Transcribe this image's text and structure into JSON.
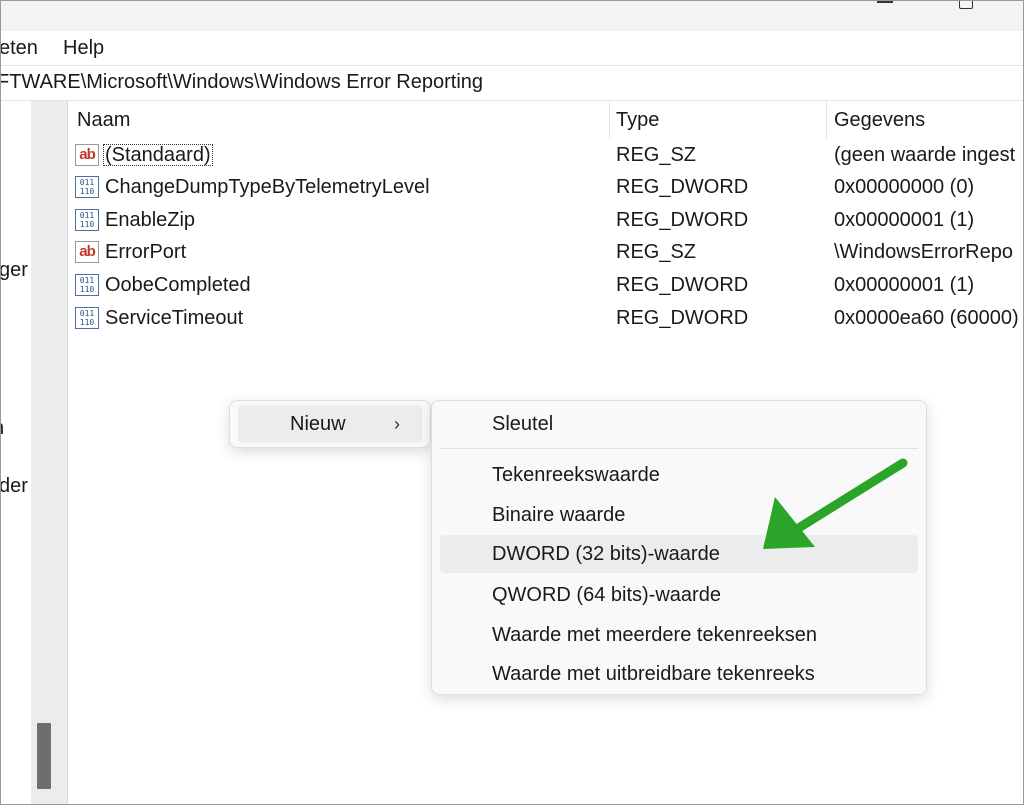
{
  "menu": [
    "eten",
    "Help"
  ],
  "address": "FTWARE\\Microsoft\\Windows\\Windows Error Reporting",
  "tree_fragments": [
    "ger",
    "n",
    "der"
  ],
  "columns": {
    "name": "Naam",
    "type": "Type",
    "data": "Gegevens"
  },
  "rows": [
    {
      "icon": "string-value-icon",
      "glyph": "ab",
      "name": "(Standaard)",
      "type": "REG_SZ",
      "data": "(geen waarde ingest"
    },
    {
      "icon": "binary-value-icon",
      "glyph": "011\n110",
      "name": "ChangeDumpTypeByTelemetryLevel",
      "type": "REG_DWORD",
      "data": "0x00000000 (0)"
    },
    {
      "icon": "binary-value-icon",
      "glyph": "011\n110",
      "name": "EnableZip",
      "type": "REG_DWORD",
      "data": "0x00000001 (1)"
    },
    {
      "icon": "string-value-icon",
      "glyph": "ab",
      "name": "ErrorPort",
      "type": "REG_SZ",
      "data": "\\WindowsErrorRepo"
    },
    {
      "icon": "binary-value-icon",
      "glyph": "011\n110",
      "name": "OobeCompleted",
      "type": "REG_DWORD",
      "data": "0x00000001 (1)"
    },
    {
      "icon": "binary-value-icon",
      "glyph": "011\n110",
      "name": "ServiceTimeout",
      "type": "REG_DWORD",
      "data": "0x0000ea60 (60000)"
    }
  ],
  "context_menu": {
    "new_label": "Nieuw",
    "chevron": "›"
  },
  "submenu": {
    "key": "Sleutel",
    "items": [
      "Tekenreekswaarde",
      "Binaire waarde",
      "DWORD (32 bits)-waarde",
      "QWORD (64 bits)-waarde",
      "Waarde met meerdere tekenreeksen",
      "Waarde met uitbreidbare tekenreeks"
    ],
    "highlighted": "DWORD (32 bits)-waarde"
  },
  "colors": {
    "arrow": "#2aa52a",
    "hover": "#ececec"
  }
}
